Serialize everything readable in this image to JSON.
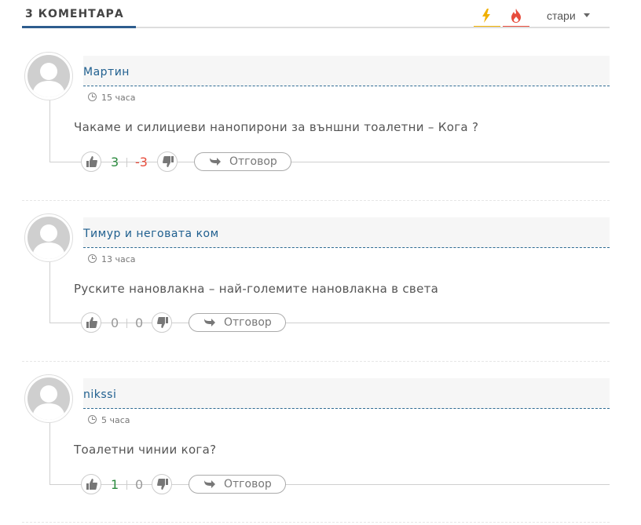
{
  "header": {
    "title": "3 КОМЕНТАРА",
    "tabs": [
      {
        "icon": "bolt-icon",
        "color": "#f0b000"
      },
      {
        "icon": "flame-icon",
        "color": "#e74c3c"
      }
    ],
    "sort_label": "стари"
  },
  "comments": [
    {
      "author": "Мартин",
      "time": "15 часа",
      "text": "Чакаме и силициеви нанопирони за външни тоалетни – Кога ?",
      "likes": "3",
      "dislikes": "-3",
      "reply_label": "Отговор"
    },
    {
      "author": "Тимур и неговата ком",
      "time": "13 часа",
      "text": "Руските нановлакна – най-големите нановлакна в света",
      "likes": "0",
      "dislikes": "0",
      "reply_label": "Отговор"
    },
    {
      "author": "nikssi",
      "time": "5 часа",
      "text": "Тоалетни чинии кога?",
      "likes": "1",
      "dislikes": "0",
      "reply_label": "Отговор"
    }
  ],
  "colors": {
    "accent": "#2e5d8e",
    "link": "#1f5f8f",
    "positive": "#2b8a3e",
    "negative": "#e74c3c"
  }
}
